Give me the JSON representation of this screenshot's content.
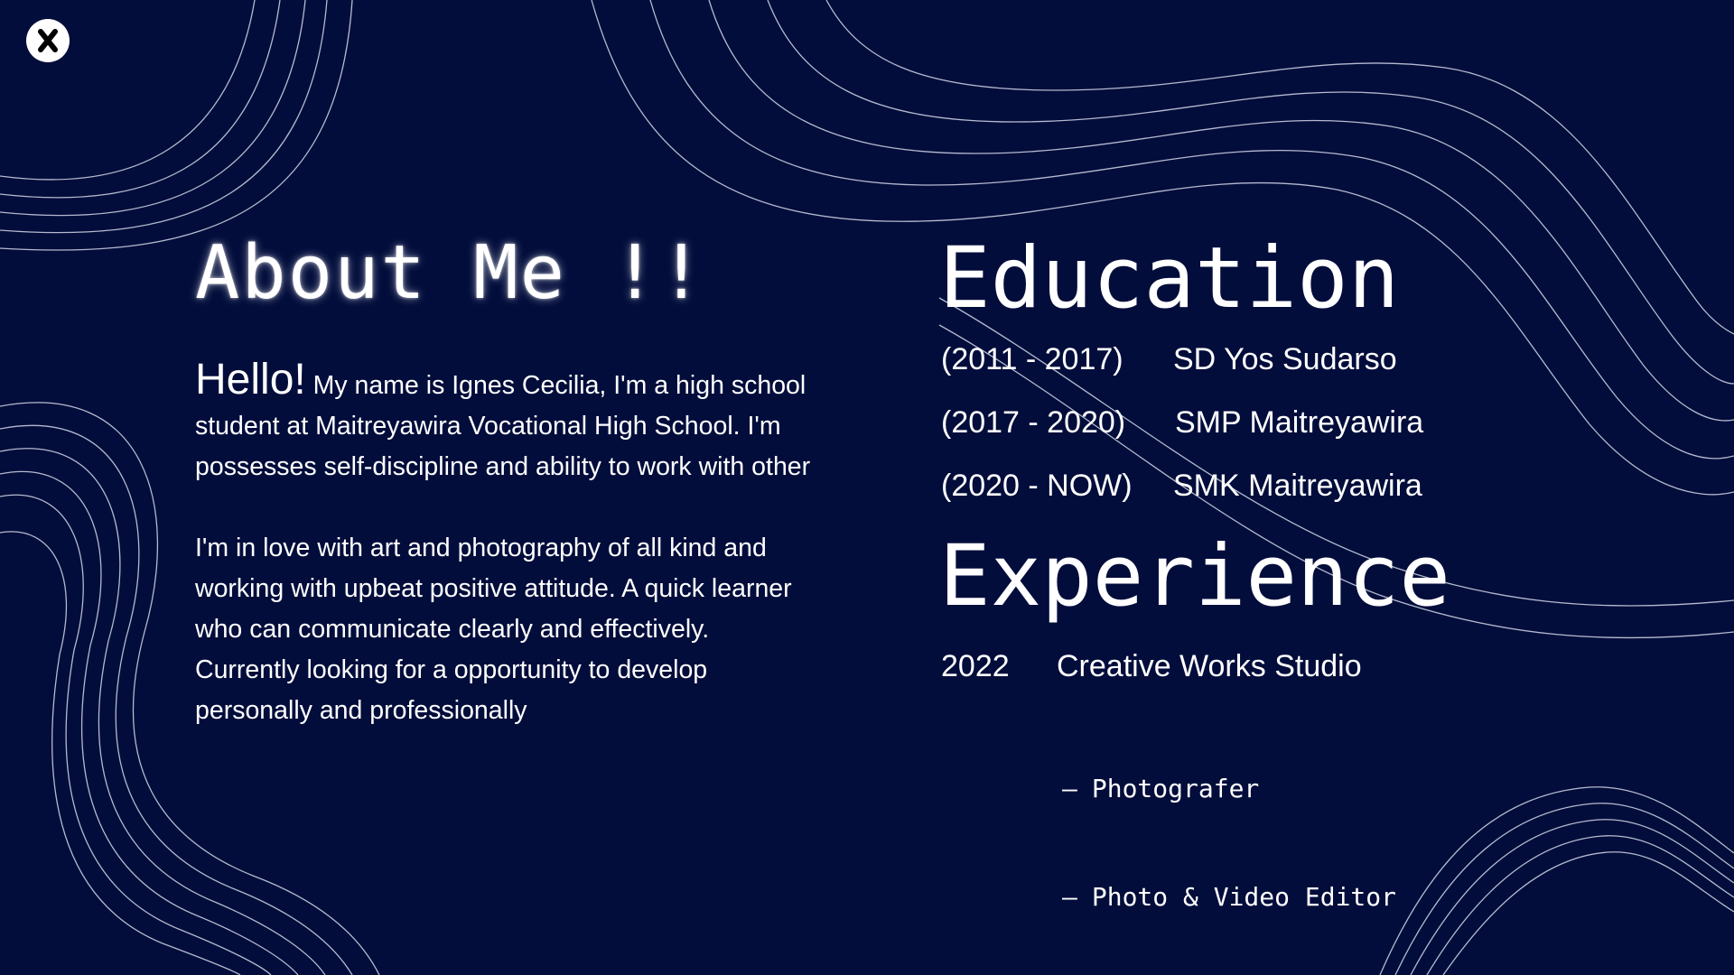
{
  "colors": {
    "background": "#020d3b",
    "text": "#ffffff",
    "decorative_lines": "#c9cde0"
  },
  "close_button": {
    "icon": "close-icon",
    "label": "X"
  },
  "about": {
    "heading": "About Me !!",
    "greeting": "Hello!",
    "intro": "My name is Ignes Cecilia, I'm a high school student at Maitreyawira Vocational High School. I'm possesses self-discipline and ability to work with other",
    "paragraph_2": "I'm in love with art and photography of all kind and working with upbeat positive attitude. A quick learner who can communicate clearly  and effectively. Currently looking for a opportunity to develop personally and professionally"
  },
  "education": {
    "heading": "Education",
    "items": [
      {
        "years": "(2011 - 2017)",
        "school": "SD Yos Sudarso"
      },
      {
        "years": "(2017 - 2020)",
        "school": "SMP Maitreyawira"
      },
      {
        "years": "(2020 - NOW)",
        "school": "SMK Maitreyawira"
      }
    ]
  },
  "experience": {
    "heading": "Experience",
    "items": [
      {
        "year": "2022",
        "company": "Creative Works Studio",
        "roles": [
          "Photografer",
          "Photo & Video Editor"
        ]
      }
    ],
    "role_bullet": "–"
  }
}
